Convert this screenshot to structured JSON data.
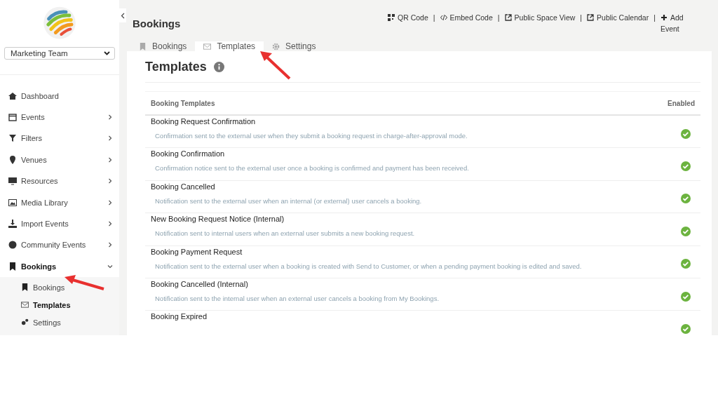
{
  "sidebar": {
    "team_select": {
      "value": "Marketing Team"
    },
    "items": [
      {
        "label": "Dashboard",
        "kind": "link",
        "selected": false
      },
      {
        "label": "Events",
        "kind": "group",
        "expanded": false,
        "selected": false
      },
      {
        "label": "Filters",
        "kind": "group",
        "expanded": false,
        "selected": false
      },
      {
        "label": "Venues",
        "kind": "group",
        "expanded": false,
        "selected": false
      },
      {
        "label": "Resources",
        "kind": "group",
        "expanded": false,
        "selected": false
      },
      {
        "label": "Media Library",
        "kind": "group",
        "expanded": false,
        "selected": false
      },
      {
        "label": "Import Events",
        "kind": "group",
        "expanded": false,
        "selected": false
      },
      {
        "label": "Community Events",
        "kind": "group",
        "expanded": false,
        "selected": false
      },
      {
        "label": "Bookings",
        "kind": "group",
        "expanded": true,
        "selected": true,
        "children": [
          {
            "label": "Bookings",
            "selected": false
          },
          {
            "label": "Templates",
            "selected": true
          },
          {
            "label": "Settings",
            "selected": false
          }
        ]
      }
    ]
  },
  "header": {
    "title": "Bookings",
    "links": [
      "QR Code",
      "Embed Code",
      "Public Space View",
      "Public Calendar",
      "Add Event"
    ],
    "separator": "|"
  },
  "tabs": [
    {
      "label": "Bookings",
      "selected": false
    },
    {
      "label": "Templates",
      "selected": true
    },
    {
      "label": "Settings",
      "selected": false
    }
  ],
  "panel": {
    "title": "Templates",
    "table": {
      "columns": [
        "Booking Templates",
        "Enabled"
      ],
      "rows": [
        {
          "name": "Booking Request Confirmation",
          "description": "Confirmation sent to the external user when they submit a booking request in charge-after-approval mode.",
          "enabled": true
        },
        {
          "name": "Booking Confirmation",
          "description": "Confirmation notice sent to the external user once a booking is confirmed and payment has been received.",
          "enabled": true
        },
        {
          "name": "Booking Cancelled",
          "description": "Notification sent to the external user when an internal (or external) user cancels a booking.",
          "enabled": true
        },
        {
          "name": "New Booking Request Notice (Internal)",
          "description": "Notification sent to internal users when an external user submits a new booking request.",
          "enabled": true
        },
        {
          "name": "Booking Payment Request",
          "description": "Notification sent to the external user when a booking is created with Send to Customer, or when a pending payment booking is edited and saved.",
          "enabled": true
        },
        {
          "name": "Booking Cancelled (Internal)",
          "description": "Notification sent to the internal user when an external user cancels a booking from My Bookings.",
          "enabled": true
        },
        {
          "name": "Booking Expired",
          "enabled": true
        }
      ]
    }
  }
}
